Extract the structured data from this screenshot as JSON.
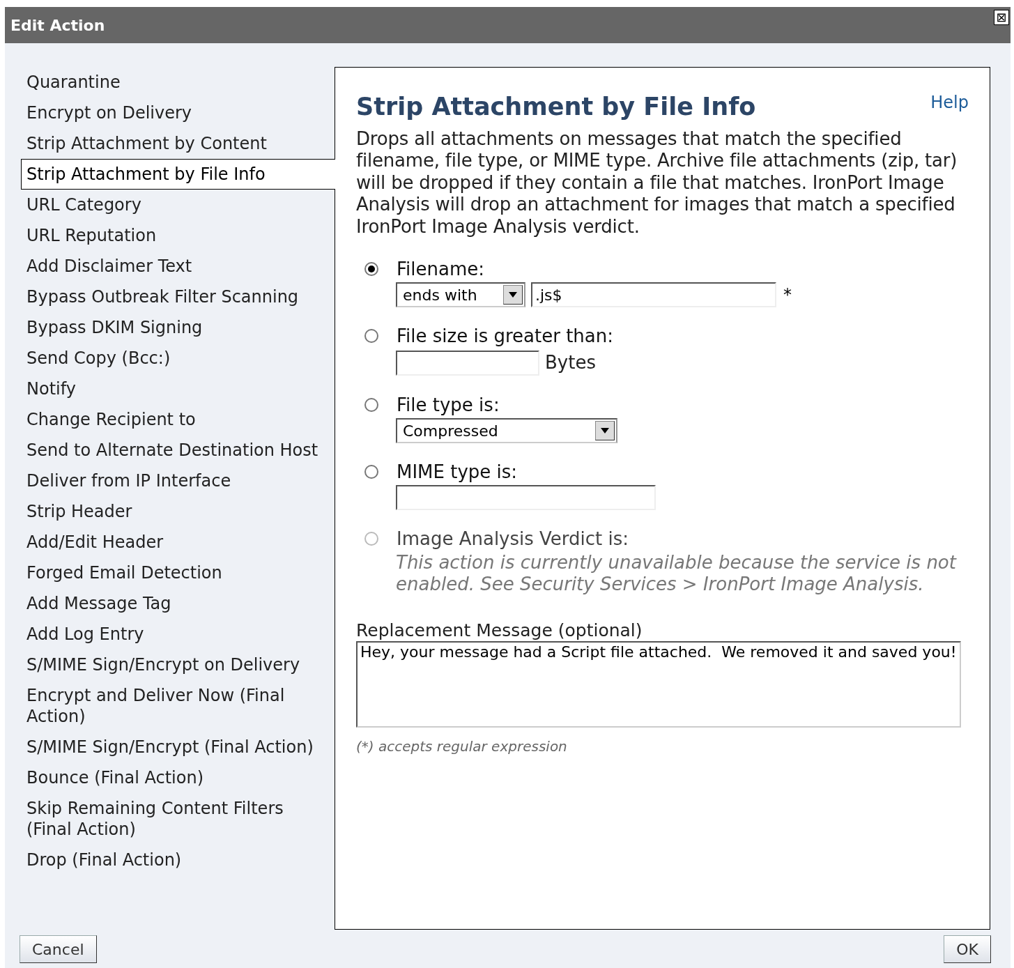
{
  "window": {
    "title": "Edit Action",
    "close_label": "⊠"
  },
  "sidebar": {
    "items": [
      {
        "label": "Quarantine",
        "selected": false
      },
      {
        "label": "Encrypt on Delivery",
        "selected": false
      },
      {
        "label": "Strip Attachment by Content",
        "selected": false
      },
      {
        "label": "Strip Attachment by File Info",
        "selected": true
      },
      {
        "label": "URL Category",
        "selected": false
      },
      {
        "label": "URL Reputation",
        "selected": false
      },
      {
        "label": "Add Disclaimer Text",
        "selected": false
      },
      {
        "label": "Bypass Outbreak Filter Scanning",
        "selected": false
      },
      {
        "label": "Bypass DKIM Signing",
        "selected": false
      },
      {
        "label": "Send Copy (Bcc:)",
        "selected": false
      },
      {
        "label": "Notify",
        "selected": false
      },
      {
        "label": "Change Recipient to",
        "selected": false
      },
      {
        "label": "Send to Alternate Destination Host",
        "selected": false
      },
      {
        "label": "Deliver from IP Interface",
        "selected": false
      },
      {
        "label": "Strip Header",
        "selected": false
      },
      {
        "label": "Add/Edit Header",
        "selected": false
      },
      {
        "label": "Forged Email Detection",
        "selected": false
      },
      {
        "label": "Add Message Tag",
        "selected": false
      },
      {
        "label": "Add Log Entry",
        "selected": false
      },
      {
        "label": "S/MIME Sign/Encrypt on Delivery",
        "selected": false
      },
      {
        "label": "Encrypt and Deliver Now (Final Action)",
        "selected": false
      },
      {
        "label": "S/MIME Sign/Encrypt (Final Action)",
        "selected": false
      },
      {
        "label": "Bounce (Final Action)",
        "selected": false
      },
      {
        "label": "Skip Remaining Content Filters (Final Action)",
        "selected": false
      },
      {
        "label": "Drop (Final Action)",
        "selected": false
      }
    ]
  },
  "panel": {
    "title": "Strip Attachment by File Info",
    "help": "Help",
    "description": "Drops all attachments on messages that match the specified filename, file type, or MIME type. Archive file attachments (zip, tar) will be dropped if they contain a file that matches. IronPort Image Analysis will drop an attachment for images that match a specified IronPort Image Analysis verdict.",
    "options": [
      {
        "kind": "filename",
        "label": "Filename:",
        "selected": true,
        "disabled": false,
        "select_value": "ends with",
        "pattern": ".js$",
        "required_mark": "*"
      },
      {
        "kind": "size",
        "label": "File size is greater than:",
        "selected": false,
        "disabled": false,
        "unit": "Bytes"
      },
      {
        "kind": "type",
        "label": "File type is:",
        "selected": false,
        "disabled": false,
        "select_value": "Compressed"
      },
      {
        "kind": "mime",
        "label": "MIME type is:",
        "selected": false,
        "disabled": false
      },
      {
        "kind": "verdict",
        "label": "Image Analysis Verdict is:",
        "selected": false,
        "disabled": true,
        "note": "This action is currently unavailable because the service is not enabled. See Security Services > IronPort Image Analysis."
      }
    ],
    "replacement": {
      "label": "Replacement Message (optional)",
      "value": "Hey, your message had a Script file attached.  We removed it and saved you!"
    },
    "footnote": "(*) accepts regular expression"
  },
  "buttons": {
    "cancel": "Cancel",
    "ok": "OK"
  }
}
